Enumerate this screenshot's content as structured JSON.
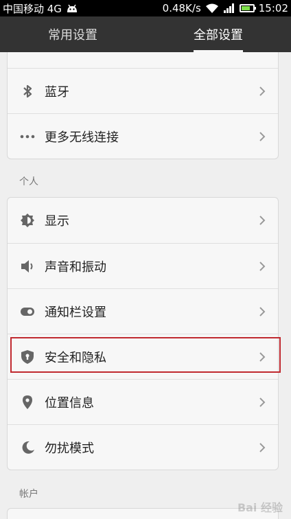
{
  "status": {
    "carrier": "中国移动 4G",
    "speed": "0.48K/s",
    "time": "15:02"
  },
  "tabs": [
    {
      "label": "常用设置",
      "active": false
    },
    {
      "label": "全部设置",
      "active": true
    }
  ],
  "sections": {
    "personal_title": "个人",
    "account_title": "帐户"
  },
  "wireless_items": [
    {
      "label": "蓝牙",
      "icon": "bluetooth-icon"
    },
    {
      "label": "更多无线连接",
      "icon": "more-dots-icon"
    }
  ],
  "personal_items": [
    {
      "label": "显示",
      "icon": "brightness-icon"
    },
    {
      "label": "声音和振动",
      "icon": "speaker-icon"
    },
    {
      "label": "通知栏设置",
      "icon": "toggle-icon"
    },
    {
      "label": "安全和隐私",
      "icon": "shield-icon"
    },
    {
      "label": "位置信息",
      "icon": "location-pin-icon"
    },
    {
      "label": "勿扰模式",
      "icon": "moon-icon"
    }
  ],
  "colors": {
    "highlight": "#c0292f",
    "tabbar": "#333333",
    "battery": "#7ee04a"
  },
  "watermark": "Bai 经验"
}
